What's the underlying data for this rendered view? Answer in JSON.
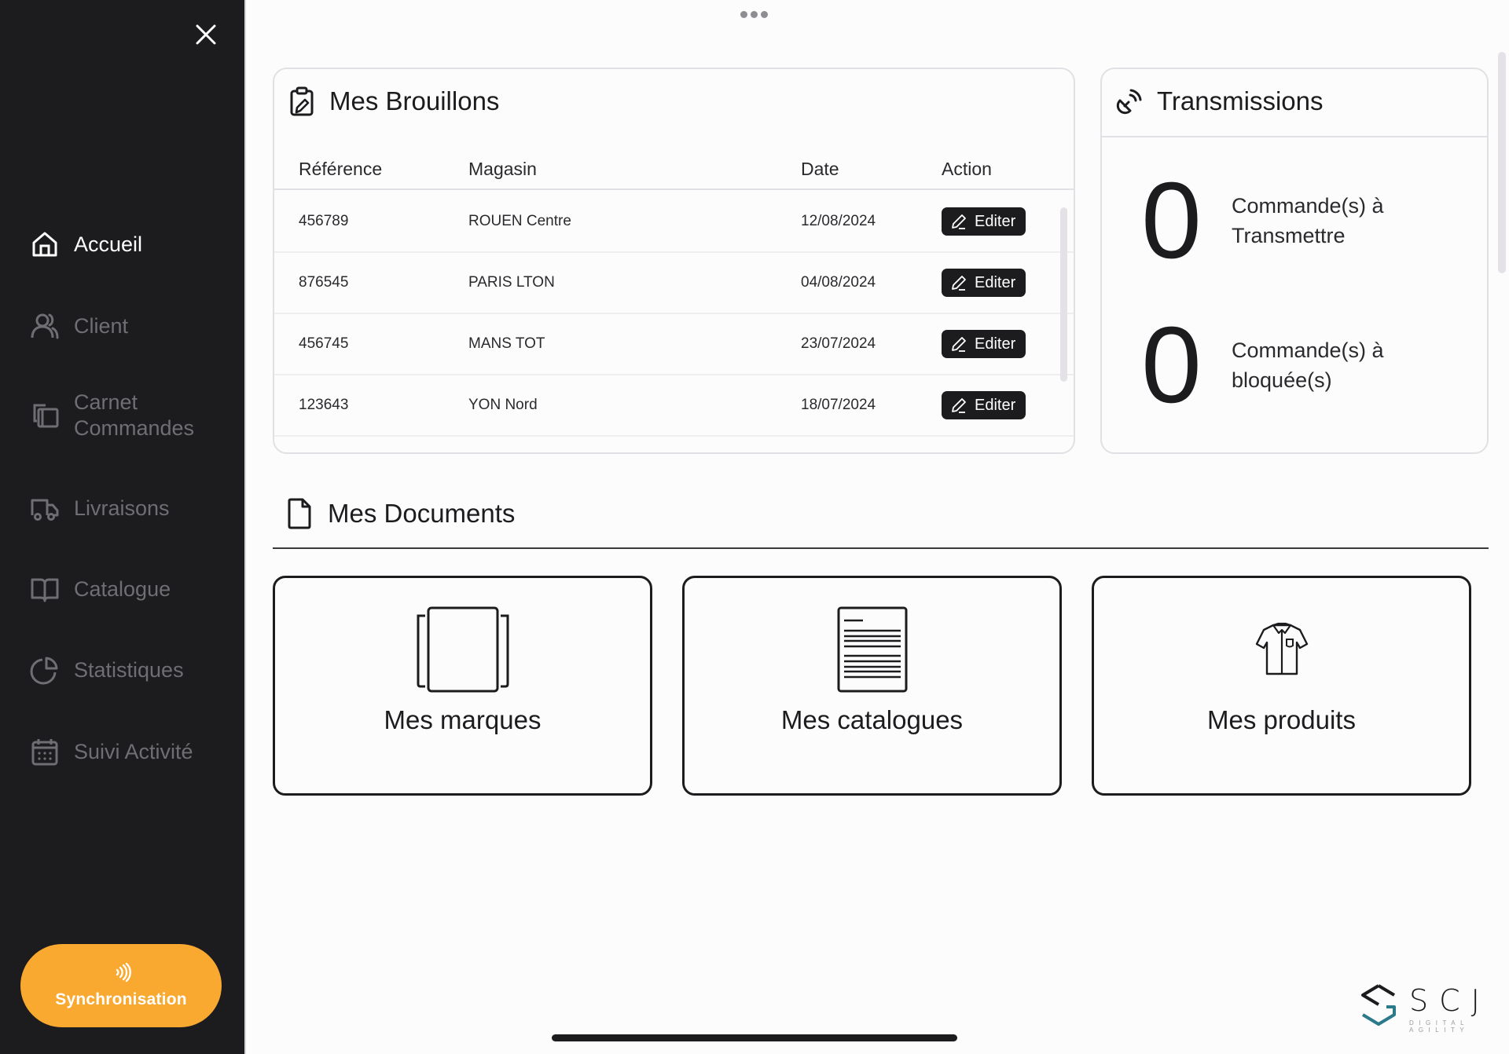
{
  "sidebar": {
    "close_icon": "close-icon",
    "items": [
      {
        "label": "Accueil",
        "icon": "home-icon",
        "active": true
      },
      {
        "label": "Client",
        "icon": "users-icon",
        "active": false
      },
      {
        "label": "Carnet Commandes",
        "icon": "order-book-icon",
        "active": false
      },
      {
        "label": "Livraisons",
        "icon": "truck-icon",
        "active": false
      },
      {
        "label": "Catalogue",
        "icon": "book-open-icon",
        "active": false
      },
      {
        "label": "Statistiques",
        "icon": "pie-chart-icon",
        "active": false
      },
      {
        "label": "Suivi Activité",
        "icon": "calendar-icon",
        "active": false
      }
    ],
    "sync_button": {
      "label": "Synchronisation",
      "icon": "sync-waves-icon",
      "color": "#f9a830"
    }
  },
  "drafts": {
    "title": "Mes Brouillons",
    "icon": "clipboard-edit-icon",
    "columns": [
      "Référence",
      "Magasin",
      "Date",
      "Action"
    ],
    "rows": [
      {
        "reference": "456789",
        "magasin": "ROUEN Centre",
        "date": "12/08/2024",
        "action": "Editer"
      },
      {
        "reference": "876545",
        "magasin": "PARIS LTON",
        "date": "04/08/2024",
        "action": "Editer"
      },
      {
        "reference": "456745",
        "magasin": "MANS TOT",
        "date": "23/07/2024",
        "action": "Editer"
      },
      {
        "reference": "123643",
        "magasin": "YON Nord",
        "date": "18/07/2024",
        "action": "Editer"
      }
    ]
  },
  "transmissions": {
    "title": "Transmissions",
    "icon": "satellite-dish-icon",
    "stats": [
      {
        "value": "0",
        "label": "Commande(s) à Transmettre"
      },
      {
        "value": "0",
        "label": "Commande(s) à bloquée(s)"
      }
    ]
  },
  "documents": {
    "title": "Mes Documents",
    "icon": "document-icon",
    "tiles": [
      {
        "label": "Mes marques",
        "icon": "brands-icon"
      },
      {
        "label": "Mes catalogues",
        "icon": "catalog-page-icon"
      },
      {
        "label": "Mes produits",
        "icon": "shirt-icon"
      }
    ]
  },
  "logo": {
    "name": "SCJ",
    "tagline": "DIGITAL AGILITY",
    "accent": "#2a7a8a"
  },
  "colors": {
    "sidebar_bg": "#1c1b1d",
    "accent": "#f9a830",
    "text": "#1c1b1d"
  }
}
